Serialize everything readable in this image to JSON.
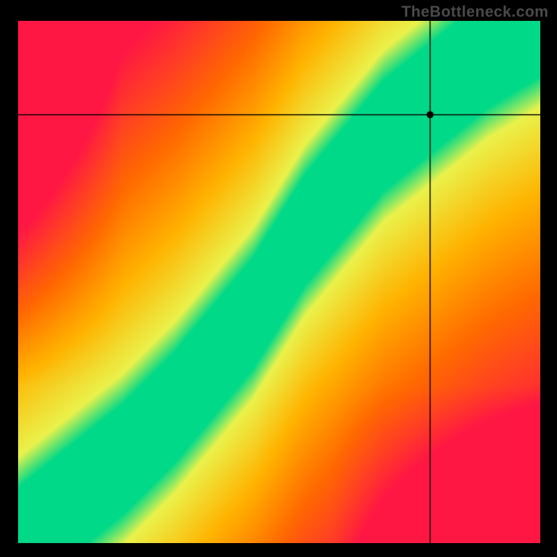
{
  "watermark": {
    "text": "TheBottleneck.com"
  },
  "chart_data": {
    "type": "heatmap",
    "title": "",
    "xlabel": "",
    "ylabel": "",
    "x_range": [
      0,
      100
    ],
    "y_range": [
      0,
      100
    ],
    "marker": {
      "x": 79,
      "y": 82
    },
    "crosshair": {
      "x": 79,
      "y": 82
    },
    "optimal_line_points": [
      {
        "x": 0,
        "y": 0
      },
      {
        "x": 10,
        "y": 8
      },
      {
        "x": 20,
        "y": 16
      },
      {
        "x": 30,
        "y": 26
      },
      {
        "x": 35,
        "y": 32
      },
      {
        "x": 40,
        "y": 38
      },
      {
        "x": 45,
        "y": 44
      },
      {
        "x": 50,
        "y": 52
      },
      {
        "x": 55,
        "y": 60
      },
      {
        "x": 60,
        "y": 66
      },
      {
        "x": 65,
        "y": 72
      },
      {
        "x": 70,
        "y": 78
      },
      {
        "x": 75,
        "y": 82
      },
      {
        "x": 80,
        "y": 86
      },
      {
        "x": 85,
        "y": 90
      },
      {
        "x": 90,
        "y": 94
      },
      {
        "x": 95,
        "y": 97
      },
      {
        "x": 100,
        "y": 100
      }
    ],
    "band_width": 6,
    "colors": {
      "optimal": "#00d988",
      "near": "#eaf24b",
      "mid": "#ffb300",
      "far": "#ff6a00",
      "extreme": "#ff1744"
    },
    "grid": false,
    "legend": null
  }
}
